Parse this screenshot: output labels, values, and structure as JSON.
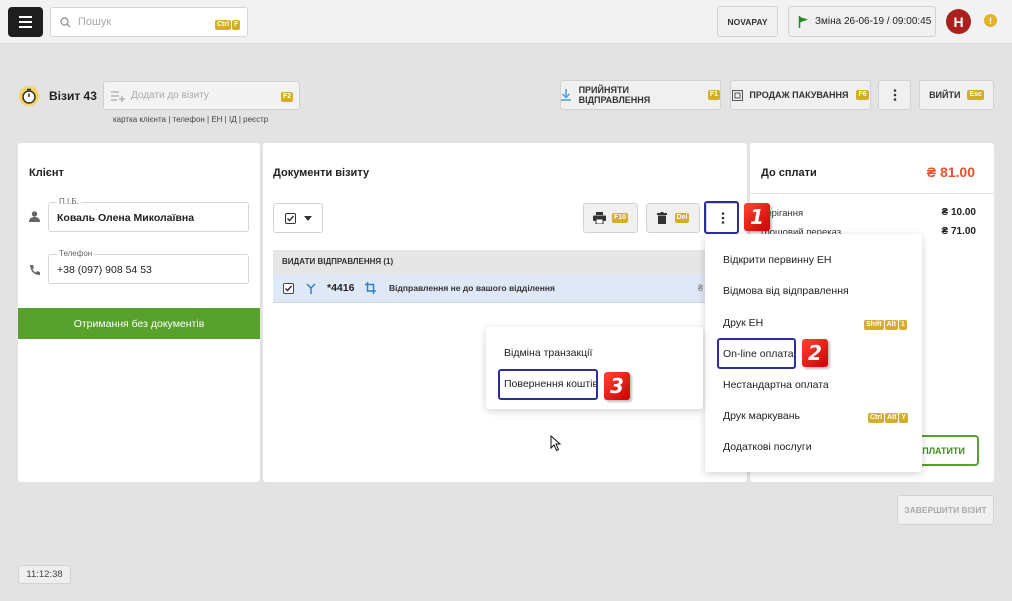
{
  "topbar": {
    "search_placeholder": "Пошук",
    "search_kbd": [
      "Ctrl",
      "F"
    ],
    "novapay_label": "NOVAPAY",
    "shift_label": "Зміна 26-06-19 / 09:00:45",
    "avatar_letter": "Н",
    "alert_icon": "!"
  },
  "visit": {
    "title": "Візит 43",
    "add_placeholder": "Додати до візиту",
    "add_kbd": "F2",
    "hint": "картка клієнта | телефон | ЕН | ІД | реєстр",
    "accept_label": "ПРИЙНЯТИ ВІДПРАВЛЕННЯ",
    "accept_kbd": "F1",
    "sell_label": "ПРОДАЖ ПАКУВАННЯ",
    "sell_kbd": "F6",
    "exit_label": "ВИЙТИ",
    "exit_kbd": "Esc"
  },
  "client": {
    "title": "Клієнт",
    "name_label": "П.І.Б.",
    "name_value": "Коваль Олена Миколаївна",
    "phone_label": "Телефон",
    "phone_value": "+38 (097) 908 54 53",
    "receive_btn": "Отримання без документів"
  },
  "docs": {
    "title": "Документи візиту",
    "print_kbd": "F10",
    "delete_kbd": "Del",
    "section_label": "ВИДАТИ ВІДПРАВЛЕННЯ (1)",
    "row": {
      "number": "*4416",
      "description": "Відправлення не до вашого відділення",
      "currency": "₴"
    }
  },
  "payment": {
    "title": "До сплати",
    "total": "₴ 81.00",
    "lines": [
      {
        "label": "берігання",
        "value": "₴ 10.00"
      },
      {
        "label": "грошовий переказ",
        "value": "₴ 71.00"
      }
    ],
    "pay_btn": "ОПЛАТИТИ",
    "finish_btn": "ЗАВЕРШИТИ ВІЗИТ"
  },
  "main_menu": {
    "items": [
      {
        "label": "Відкрити первинну ЕН",
        "kbd": []
      },
      {
        "label": "Відмова від відправлення",
        "kbd": []
      },
      {
        "label": "Друк ЕН",
        "kbd": [
          "Shift",
          "Alt",
          "1"
        ]
      },
      {
        "label": "On-line оплата",
        "kbd": []
      },
      {
        "label": "Нестандартна оплата",
        "kbd": []
      },
      {
        "label": "Друк маркувань",
        "kbd": [
          "Ctrl",
          "Alt",
          "Y"
        ]
      },
      {
        "label": "Додаткові послуги",
        "kbd": []
      }
    ]
  },
  "sub_menu": {
    "items": [
      {
        "label": "Відміна транзакції"
      },
      {
        "label": "Повернення коштів"
      }
    ]
  },
  "badges": [
    "1",
    "2",
    "3"
  ],
  "clock": "11:12:38",
  "colors": {
    "accent_green": "#57a12c",
    "brand_yellow": "#d4ad2b",
    "total_red": "#e8512b",
    "highlight": "#2c2f9a"
  }
}
